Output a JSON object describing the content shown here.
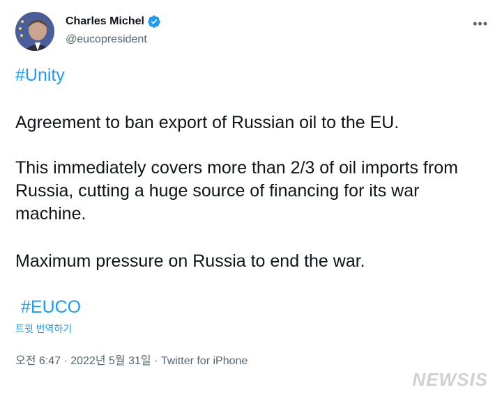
{
  "user": {
    "display_name": "Charles Michel",
    "handle": "@eucopresident",
    "verified": true
  },
  "tweet": {
    "hashtag_top": "#Unity",
    "paragraph1": "Agreement to ban export of Russian oil to the EU.",
    "paragraph2": "This immediately covers more than 2/3 of oil imports from Russia, cutting a huge source of financing for its war machine.",
    "paragraph3": "Maximum pressure on Russia to end the war.",
    "hashtag_bottom": "#EUCO",
    "translate_label": "트윗 번역하기",
    "timestamp": "오전 6:47 · 2022년 5월 31일 · Twitter for iPhone"
  },
  "icons": {
    "more": "more-horizontal-icon",
    "verified": "verified-badge-icon"
  },
  "more_glyph": "•••",
  "watermark": "NEWSIS",
  "colors": {
    "link": "#1d9bf0",
    "secondary": "#536471",
    "text": "#0f1419"
  }
}
